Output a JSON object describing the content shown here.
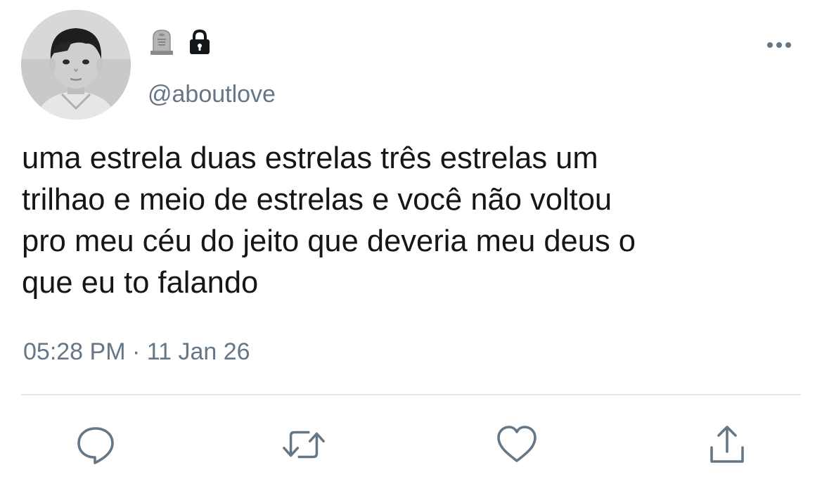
{
  "tweet": {
    "handle": "@aboutlove",
    "name_icons": [
      "headstone-icon",
      "lock-icon"
    ],
    "text": "uma estrela duas estrelas três estrelas um\ntrilhao e meio de estrelas e você não voltou\npro meu céu do jeito que deveria meu deus o\nque eu to falando",
    "timestamp": "05:28 PM · 11 Jan 26"
  },
  "actions": [
    {
      "name": "reply",
      "icon": "speech-bubble-icon"
    },
    {
      "name": "retweet",
      "icon": "retweet-arrows-icon"
    },
    {
      "name": "like",
      "icon": "heart-icon"
    },
    {
      "name": "share",
      "icon": "share-upload-icon"
    }
  ],
  "colors": {
    "text": "#14171a",
    "secondary": "#657786",
    "action_icon": "#657786",
    "divider": "#e1e8ed"
  }
}
